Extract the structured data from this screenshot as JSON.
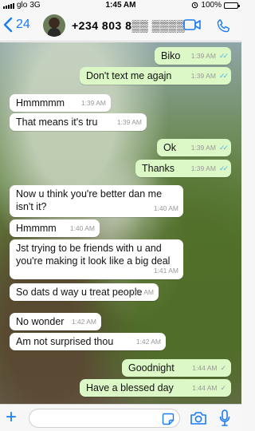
{
  "status_bar": {
    "carrier": "glo",
    "network": "3G",
    "time": "1:45 AM",
    "battery": "100%",
    "battery_level": 1.0
  },
  "header": {
    "back_count": "24",
    "contact_name": "+234 803 8▒▒ ▒▒▒▒",
    "icons": [
      "chevron-left-icon",
      "video-call-icon",
      "phone-icon"
    ],
    "accent_color": "#1a7cf5"
  },
  "messages": [
    {
      "direction": "out",
      "text": "Biko",
      "time": "1:39 AM",
      "status": "read"
    },
    {
      "direction": "out",
      "text": "Don't text me agajn",
      "time": "1:39 AM",
      "status": "read"
    },
    {
      "direction": "in",
      "text": "Hmmmmm",
      "time": "1:39 AM"
    },
    {
      "direction": "in",
      "text": "That means it's tru",
      "time": "1:39 AM"
    },
    {
      "direction": "out",
      "text": "Ok",
      "time": "1:39 AM",
      "status": "read"
    },
    {
      "direction": "out",
      "text": "Thanks",
      "time": "1:39 AM",
      "status": "read"
    },
    {
      "direction": "in",
      "text": "Now u think you're better dan me isn't it?",
      "time": "1:40 AM"
    },
    {
      "direction": "in",
      "text": "Hmmmm",
      "time": "1:40 AM"
    },
    {
      "direction": "in",
      "text": "Jst trying to be friends with u and you're making it look like a big deal",
      "time": "1:41 AM"
    },
    {
      "direction": "in",
      "text": "So dats d way u treat people",
      "time": "1:41 AM"
    },
    {
      "direction": "in",
      "text": "No wonder",
      "time": "1:42 AM"
    },
    {
      "direction": "in",
      "text": "Am not surprised thou",
      "time": "1:42 AM"
    },
    {
      "direction": "out",
      "text": "Goodnight",
      "time": "1:44 AM",
      "status": "delivered"
    },
    {
      "direction": "out",
      "text": "Have a blessed day",
      "time": "1:44 AM",
      "status": "delivered"
    }
  ],
  "input_bar": {
    "placeholder": "",
    "icons": [
      "plus-icon",
      "sticker-icon",
      "camera-icon",
      "microphone-icon"
    ]
  },
  "colors": {
    "outgoing_bubble": "#dcf8c6",
    "incoming_bubble": "#ffffff",
    "read_tick": "#4fb6ec"
  }
}
